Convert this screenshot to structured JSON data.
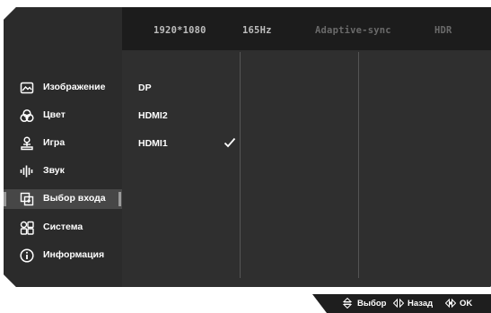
{
  "header": {
    "resolution": "1920*1080",
    "refresh_rate": "165Hz",
    "adaptive_sync": "Adaptive-sync",
    "hdr": "HDR"
  },
  "menu": {
    "items": [
      {
        "label": "Изображение",
        "icon": "image-icon"
      },
      {
        "label": "Цвет",
        "icon": "color-icon"
      },
      {
        "label": "Игра",
        "icon": "game-icon"
      },
      {
        "label": "Звук",
        "icon": "sound-icon"
      },
      {
        "label": "Выбор входа",
        "icon": "input-select-icon",
        "selected": true
      },
      {
        "label": "Система",
        "icon": "system-icon"
      },
      {
        "label": "Информация",
        "icon": "info-icon"
      }
    ]
  },
  "inputs": {
    "options": [
      {
        "label": "DP"
      },
      {
        "label": "HDMI2"
      },
      {
        "label": "HDMI1",
        "checked": true
      }
    ]
  },
  "footer": {
    "select_label": "Выбор",
    "back_label": "Назад",
    "ok_label": "OK"
  },
  "colors": {
    "panel_bg": "#303030",
    "header_bg": "#1c1c1c",
    "selected_bg": "#474747",
    "text": "#ffffff",
    "inactive_header_text": "#6a6a6a"
  }
}
